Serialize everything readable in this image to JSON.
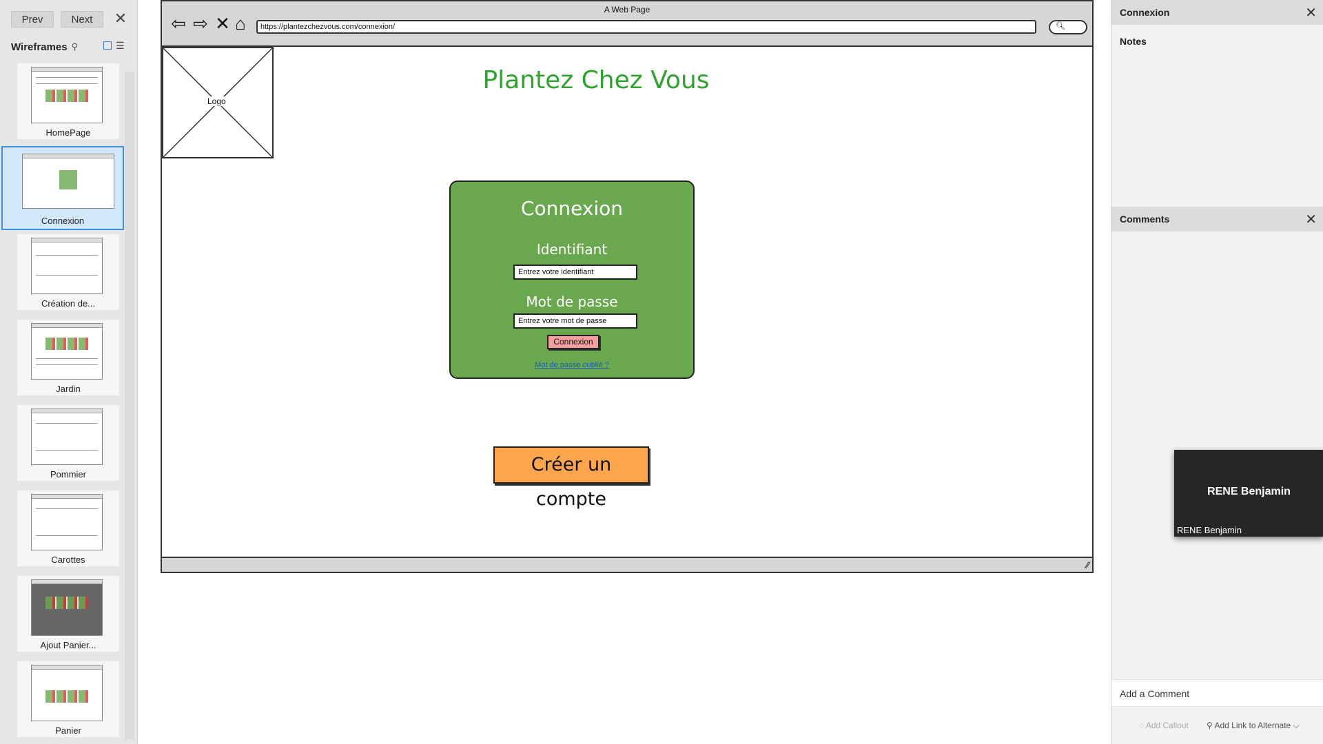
{
  "nav": {
    "prev": "Prev",
    "next": "Next",
    "close": "✕"
  },
  "wireframes": {
    "title": "Wireframes",
    "items": [
      {
        "label": "HomePage"
      },
      {
        "label": "Connexion",
        "selected": true
      },
      {
        "label": "Création de..."
      },
      {
        "label": "Jardin"
      },
      {
        "label": "Pommier"
      },
      {
        "label": "Carottes"
      },
      {
        "label": "Ajout Panier..."
      },
      {
        "label": "Panier"
      }
    ]
  },
  "browser": {
    "window_title": "A Web Page",
    "url": "https://plantezchezvous.com/connexion/"
  },
  "page": {
    "logo": "Logo",
    "site_title": "Plantez Chez Vous",
    "login": {
      "heading": "Connexion",
      "id_label": "Identifiant",
      "id_placeholder": "Entrez votre identifiant",
      "pw_label": "Mot de passe",
      "pw_placeholder": "Entrez votre mot de passe",
      "button": "Connexion",
      "forgot": "Mot de passe oublié ?"
    },
    "create_account": "Créer un compte"
  },
  "right": {
    "panel_title": "Connexion",
    "notes": "Notes",
    "comments": "Comments",
    "video_name": "RENE Benjamin",
    "video_caption": "RENE Benjamin",
    "comment_placeholder": "Add a Comment",
    "add_callout": "Add Callout",
    "add_link": "Add Link to Alternate"
  },
  "colors": {
    "login_card": "#6aa84f",
    "site_title": "#2ea32e",
    "create_button": "#ffa54b",
    "connexion_button": "#f4a0a0",
    "selection": "#3d8fe3"
  }
}
